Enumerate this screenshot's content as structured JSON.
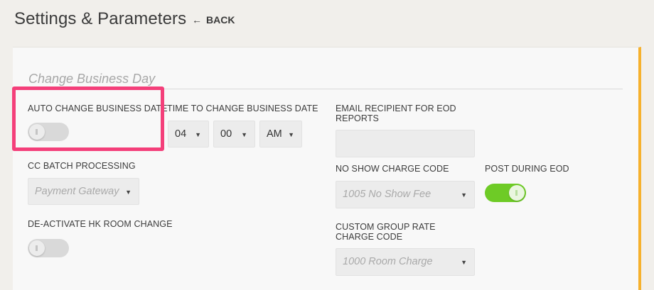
{
  "header": {
    "title": "Settings & Parameters",
    "back_label": "BACK"
  },
  "section": {
    "title": "Change Business Day"
  },
  "fields": {
    "auto_change": {
      "label": "AUTO CHANGE BUSINESS DATE",
      "on": false
    },
    "time_to_change": {
      "label": "TIME TO CHANGE BUSINESS DATE",
      "hour": "04",
      "minute": "00",
      "meridiem": "AM"
    },
    "email_recipient": {
      "label": "EMAIL RECIPIENT FOR EOD REPORTS",
      "value": ""
    },
    "cc_batch": {
      "label": "CC BATCH PROCESSING",
      "value": "Payment Gateway"
    },
    "no_show_charge": {
      "label": "NO SHOW CHARGE CODE",
      "value": "1005 No Show Fee"
    },
    "post_during_eod": {
      "label": "POST DURING EOD",
      "on": true
    },
    "deactivate_hk": {
      "label": "DE-ACTIVATE HK ROOM CHANGE",
      "on": false
    },
    "custom_group_rate": {
      "label": "CUSTOM GROUP RATE CHARGE CODE",
      "value": "1000 Room Charge"
    }
  },
  "colors": {
    "highlight": "#f43f7a",
    "toggle_on": "#6ecb26",
    "panel_accent": "#f6b12d"
  }
}
